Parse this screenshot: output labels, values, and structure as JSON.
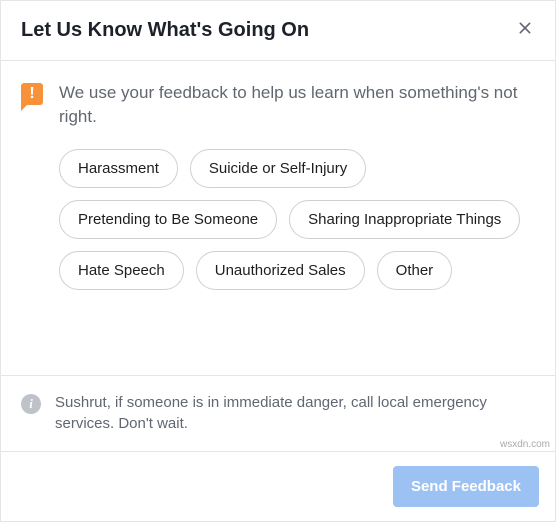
{
  "header": {
    "title": "Let Us Know What's Going On"
  },
  "intro": {
    "text": "We use your feedback to help us learn when something's not right."
  },
  "options": [
    "Harassment",
    "Suicide or Self-Injury",
    "Pretending to Be Someone",
    "Sharing Inappropriate Things",
    "Hate Speech",
    "Unauthorized Sales",
    "Other"
  ],
  "notice": {
    "text": "Sushrut, if someone is in immediate danger, call local emergency services. Don't wait."
  },
  "footer": {
    "send_label": "Send Feedback"
  },
  "watermark": "wsxdn.com",
  "colors": {
    "accent_orange": "#f7923b",
    "button_blue": "#9cc2f4",
    "text_gray": "#606770"
  }
}
